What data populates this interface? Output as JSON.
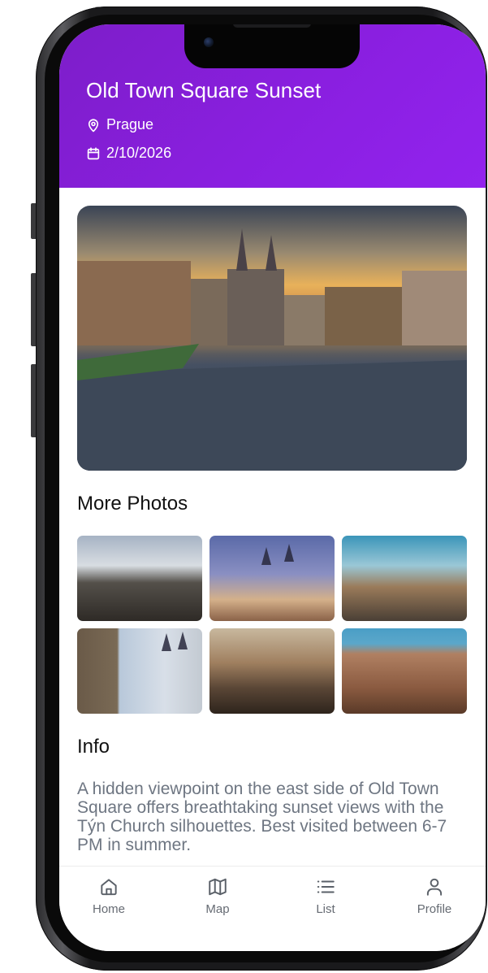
{
  "header": {
    "title": "Old Town Square Sunset",
    "location": "Prague",
    "date": "2/10/2026",
    "background_color": "#8a1fe0"
  },
  "hero": {
    "alt_icon": "hero-photo"
  },
  "more_photos": {
    "title": "More Photos",
    "thumbnails": [
      "photo-1",
      "photo-2",
      "photo-3",
      "photo-4",
      "photo-5",
      "photo-6"
    ]
  },
  "info": {
    "title": "Info",
    "text": "A hidden viewpoint on the east side of Old Town Square offers breathtaking sunset views with the Týn Church silhouettes. Best visited between 6-7 PM in summer."
  },
  "tabbar": {
    "items": [
      {
        "label": "Home",
        "icon": "home-icon"
      },
      {
        "label": "Map",
        "icon": "map-icon"
      },
      {
        "label": "List",
        "icon": "list-icon"
      },
      {
        "label": "Profile",
        "icon": "profile-icon"
      }
    ]
  }
}
